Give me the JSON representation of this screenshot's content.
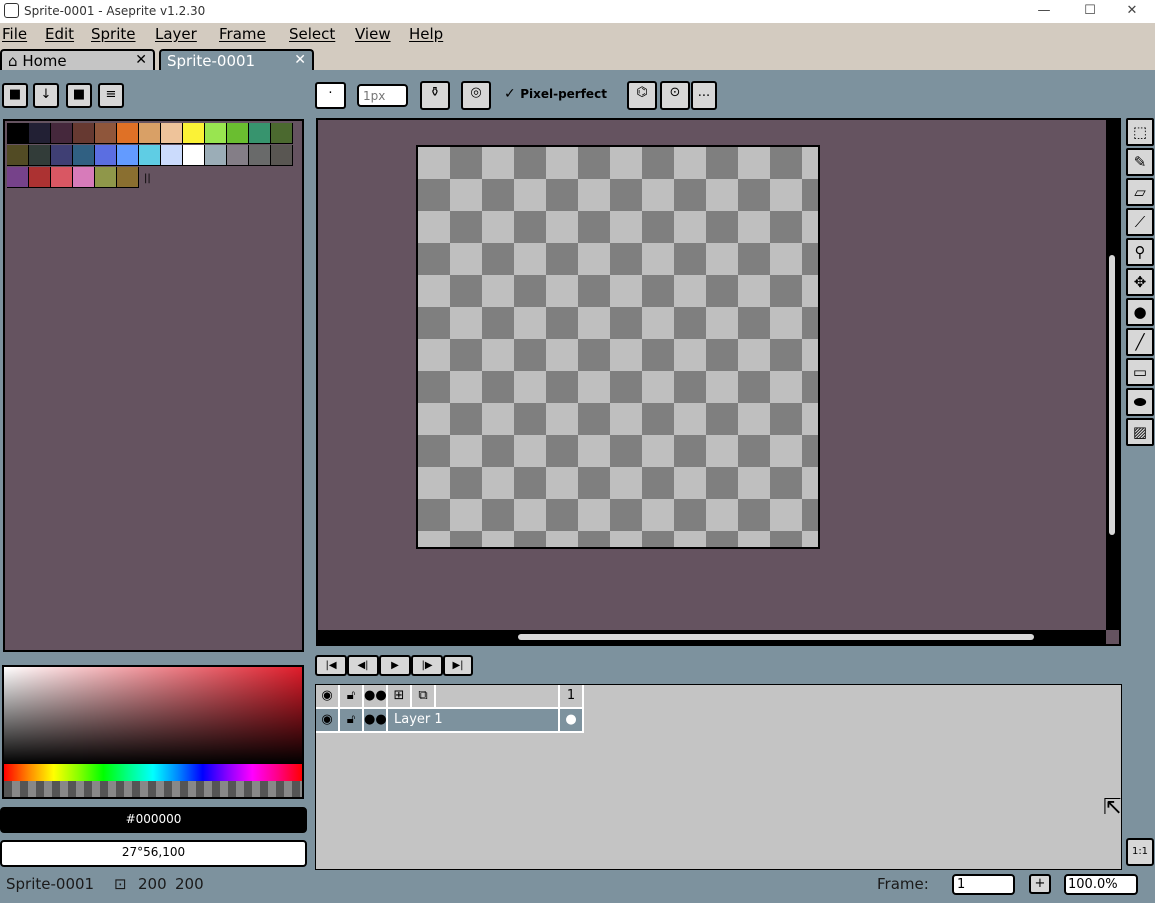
{
  "window": {
    "title": "Sprite-0001 - Aseprite v1.2.30",
    "minimize": "—",
    "maximize": "☐",
    "close": "✕"
  },
  "menu": [
    "File",
    "Edit",
    "Sprite",
    "Layer",
    "Frame",
    "Select",
    "View",
    "Help"
  ],
  "tabs": [
    {
      "label": "Home",
      "icon": "home-icon",
      "close": "✕"
    },
    {
      "label": "Sprite-0001",
      "close": "✕"
    }
  ],
  "toolbar": {
    "brush_size_placeholder": "1px",
    "pixel_perfect": "Pixel-perfect",
    "more": "..."
  },
  "palette": {
    "colors": [
      "#000000",
      "#222034",
      "#45283c",
      "#663931",
      "#8f563b",
      "#df7126",
      "#d9a066",
      "#eec39a",
      "#fbf236",
      "#99e550",
      "#6abe30",
      "#37946e",
      "#4b692f",
      "#524b24",
      "#323c39",
      "#3f3f74",
      "#306082",
      "#5b6ee1",
      "#639bff",
      "#5fcde4",
      "#cbdbfc",
      "#ffffff",
      "#9badb7",
      "#847e87",
      "#696a6a",
      "#595652",
      "#76428a",
      "#ac3232",
      "#d95763",
      "#d77bba",
      "#8f974a",
      "#8a6f30"
    ]
  },
  "color_hex": "#000000",
  "color_hsv": "27°56,100",
  "animation_controls": [
    "first-frame-icon",
    "previous-frame-icon",
    "play-icon",
    "next-frame-icon",
    "last-frame-icon"
  ],
  "timeline": {
    "frame_number": "1",
    "layer_name": "Layer 1"
  },
  "tools": [
    "rectangular-marquee-icon",
    "pencil-icon",
    "eraser-icon",
    "eyedropper-icon",
    "zoom-icon",
    "move-icon",
    "paint-bucket-icon",
    "line-icon",
    "rectangle-icon",
    "contour-icon",
    "blur-icon"
  ],
  "zoom_reset": "1:1",
  "status": {
    "sprite_name": "Sprite-0001",
    "width": "200",
    "height": "200",
    "frame_label": "Frame:",
    "frame_value": "1",
    "add": "+",
    "zoom": "100.0%"
  }
}
